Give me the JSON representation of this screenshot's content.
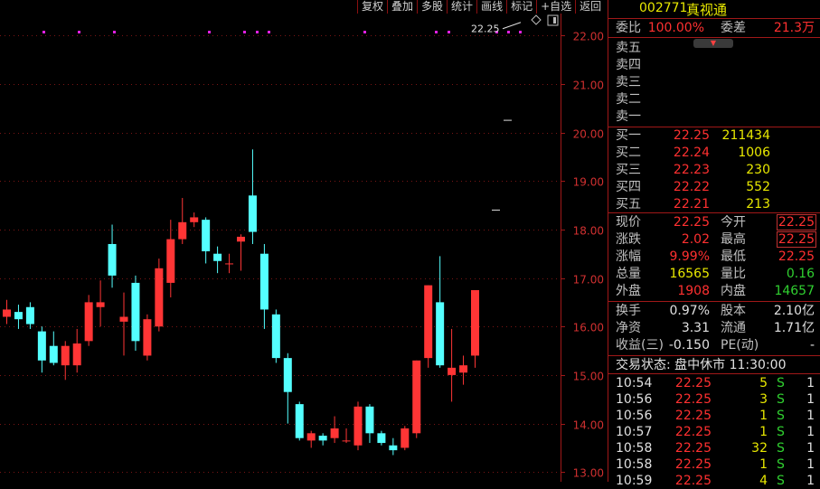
{
  "toolbar": [
    "复权",
    "叠加",
    "多股",
    "统计",
    "画线",
    "标记",
    "+自选",
    "返回"
  ],
  "chart_data": {
    "type": "candlestick",
    "y_ticks": [
      "22.00",
      "21.00",
      "20.00",
      "19.00",
      "18.00",
      "17.00",
      "16.00",
      "15.00",
      "14.00",
      "13.00"
    ],
    "ylim": [
      12.8,
      22.45
    ],
    "last_price_label": "22.25",
    "candles": [
      {
        "o": 16.2,
        "h": 16.55,
        "l": 16.05,
        "c": 16.35
      },
      {
        "o": 16.3,
        "h": 16.45,
        "l": 15.95,
        "c": 16.15
      },
      {
        "o": 16.4,
        "h": 16.5,
        "l": 15.95,
        "c": 16.05
      },
      {
        "o": 15.9,
        "h": 16.0,
        "l": 15.05,
        "c": 15.3
      },
      {
        "o": 15.6,
        "h": 15.9,
        "l": 15.2,
        "c": 15.25
      },
      {
        "o": 15.2,
        "h": 15.7,
        "l": 14.9,
        "c": 15.6
      },
      {
        "o": 15.2,
        "h": 15.95,
        "l": 15.05,
        "c": 15.65
      },
      {
        "o": 15.7,
        "h": 16.65,
        "l": 15.6,
        "c": 16.5
      },
      {
        "o": 16.4,
        "h": 16.95,
        "l": 16.0,
        "c": 16.5
      },
      {
        "o": 17.7,
        "h": 18.1,
        "l": 16.8,
        "c": 17.05
      },
      {
        "o": 16.1,
        "h": 16.7,
        "l": 15.4,
        "c": 16.2
      },
      {
        "o": 16.9,
        "h": 17.05,
        "l": 15.5,
        "c": 15.7
      },
      {
        "o": 15.4,
        "h": 16.25,
        "l": 15.3,
        "c": 16.15
      },
      {
        "o": 16.0,
        "h": 17.4,
        "l": 15.9,
        "c": 17.2
      },
      {
        "o": 16.9,
        "h": 18.2,
        "l": 16.6,
        "c": 17.8
      },
      {
        "o": 17.8,
        "h": 18.65,
        "l": 17.7,
        "c": 18.15
      },
      {
        "o": 18.15,
        "h": 18.35,
        "l": 18.05,
        "c": 18.25
      },
      {
        "o": 18.2,
        "h": 18.25,
        "l": 17.3,
        "c": 17.55
      },
      {
        "o": 17.5,
        "h": 17.65,
        "l": 17.1,
        "c": 17.35
      },
      {
        "o": 17.3,
        "h": 17.5,
        "l": 17.1,
        "c": 17.3
      },
      {
        "o": 17.75,
        "h": 17.9,
        "l": 17.15,
        "c": 17.85
      },
      {
        "o": 18.7,
        "h": 19.65,
        "l": 17.7,
        "c": 17.95
      },
      {
        "o": 17.5,
        "h": 17.7,
        "l": 15.95,
        "c": 16.35
      },
      {
        "o": 16.25,
        "h": 16.35,
        "l": 15.25,
        "c": 15.35
      },
      {
        "o": 15.35,
        "h": 15.45,
        "l": 14.0,
        "c": 14.65
      },
      {
        "o": 14.4,
        "h": 14.45,
        "l": 13.65,
        "c": 13.7
      },
      {
        "o": 13.65,
        "h": 13.85,
        "l": 13.5,
        "c": 13.8
      },
      {
        "o": 13.75,
        "h": 13.8,
        "l": 13.55,
        "c": 13.65
      },
      {
        "o": 13.7,
        "h": 14.15,
        "l": 13.6,
        "c": 13.9
      },
      {
        "o": 13.65,
        "h": 13.9,
        "l": 13.6,
        "c": 13.65
      },
      {
        "o": 13.55,
        "h": 14.45,
        "l": 13.45,
        "c": 14.35
      },
      {
        "o": 14.35,
        "h": 14.4,
        "l": 13.6,
        "c": 13.8
      },
      {
        "o": 13.8,
        "h": 13.85,
        "l": 13.55,
        "c": 13.6
      },
      {
        "o": 13.55,
        "h": 13.7,
        "l": 13.35,
        "c": 13.45
      },
      {
        "o": 13.5,
        "h": 13.95,
        "l": 13.45,
        "c": 13.9
      },
      {
        "o": 13.8,
        "h": 15.3,
        "l": 13.7,
        "c": 15.3
      },
      {
        "o": 15.35,
        "h": 16.85,
        "l": 15.15,
        "c": 16.85
      },
      {
        "o": 16.5,
        "h": 17.45,
        "l": 15.15,
        "c": 15.2
      },
      {
        "o": 15.0,
        "h": 15.95,
        "l": 14.45,
        "c": 15.15
      },
      {
        "o": 15.05,
        "h": 15.4,
        "l": 14.8,
        "c": 15.2
      },
      {
        "o": 15.4,
        "h": 16.75,
        "l": 15.15,
        "c": 16.75
      }
    ]
  },
  "panel": {
    "code": "002771",
    "name": "真视通",
    "weibi_label": "委比",
    "weibi": "100.00%",
    "weicha_label": "委差",
    "weicha": "21.3万",
    "dropdown_icon": "chevron-down",
    "sell": [
      "卖五",
      "卖四",
      "卖三",
      "卖二",
      "卖一"
    ],
    "buy": [
      {
        "label": "买一",
        "price": "22.25",
        "vol": "211434"
      },
      {
        "label": "买二",
        "price": "22.24",
        "vol": "1006"
      },
      {
        "label": "买三",
        "price": "22.23",
        "vol": "230"
      },
      {
        "label": "买四",
        "price": "22.22",
        "vol": "552"
      },
      {
        "label": "买五",
        "price": "22.21",
        "vol": "213"
      }
    ],
    "stats": [
      {
        "l1": "现价",
        "v1": "22.25",
        "c1": "red",
        "l2": "今开",
        "v2": "22.25",
        "c2": "red",
        "box": true
      },
      {
        "l1": "涨跌",
        "v1": "2.02",
        "c1": "red",
        "l2": "最高",
        "v2": "22.25",
        "c2": "red",
        "box": true
      },
      {
        "l1": "涨幅",
        "v1": "9.99%",
        "c1": "red",
        "l2": "最低",
        "v2": "22.25",
        "c2": "red",
        "box": false
      },
      {
        "l1": "总量",
        "v1": "16565",
        "c1": "yel",
        "l2": "量比",
        "v2": "0.16",
        "c2": "grn",
        "box": false
      },
      {
        "l1": "外盘",
        "v1": "1908",
        "c1": "red",
        "l2": "内盘",
        "v2": "14657",
        "c2": "grn",
        "box": false
      }
    ],
    "fund": [
      {
        "l1": "换手",
        "v1": "0.97%",
        "l2": "股本",
        "v2": "2.10亿"
      },
      {
        "l1": "净资",
        "v1": "3.31",
        "l2": "流通",
        "v2": "1.71亿"
      },
      {
        "l1": "收益(三)",
        "v1": "-0.150",
        "l2": "PE(动)",
        "v2": "-"
      }
    ],
    "status": "交易状态: 盘中休市 11:30:00",
    "trades": [
      {
        "t": "10:54",
        "p": "22.25",
        "v": "5",
        "f": "S",
        "n": "1"
      },
      {
        "t": "10:56",
        "p": "22.25",
        "v": "3",
        "f": "S",
        "n": "1"
      },
      {
        "t": "10:56",
        "p": "22.25",
        "v": "1",
        "f": "S",
        "n": "1"
      },
      {
        "t": "10:57",
        "p": "22.25",
        "v": "1",
        "f": "S",
        "n": "1"
      },
      {
        "t": "10:58",
        "p": "22.25",
        "v": "32",
        "f": "S",
        "n": "1"
      },
      {
        "t": "10:58",
        "p": "22.25",
        "v": "1",
        "f": "S",
        "n": "1"
      },
      {
        "t": "10:59",
        "p": "22.25",
        "v": "4",
        "f": "S",
        "n": "1"
      }
    ]
  }
}
